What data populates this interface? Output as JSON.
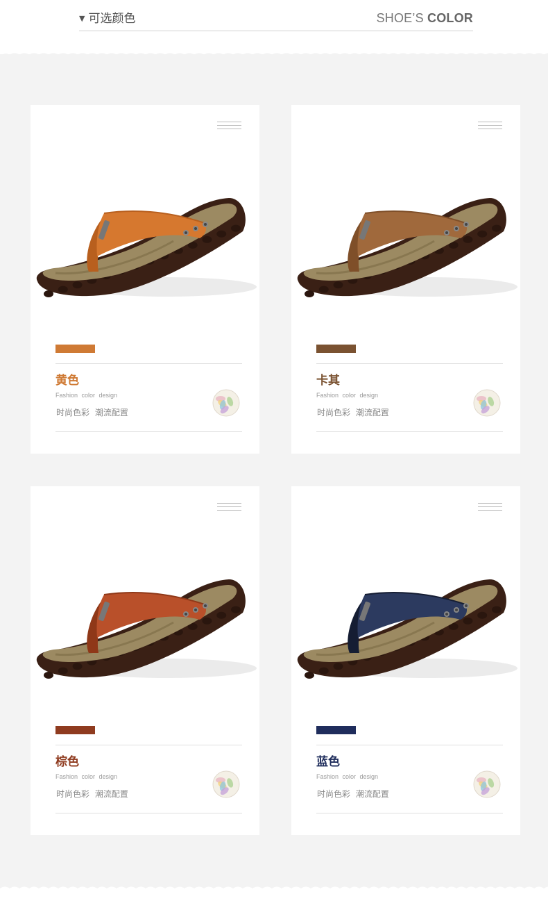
{
  "header": {
    "title_cn": "可选颜色",
    "title_en_light": "SHOE’S",
    "title_en_bold": "COLOR"
  },
  "cards": [
    {
      "name": "黄色",
      "color": "#cf7a34",
      "fashion": "Fashion color design",
      "subtitle": "时尚色彩 潮流配置",
      "strap": "#d6782f",
      "strap_dark": "#b85f1e"
    },
    {
      "name": "卡其",
      "color": "#7a5231",
      "fashion": "Fashion color design",
      "subtitle": "时尚色彩 潮流配置",
      "strap": "#a0693c",
      "strap_dark": "#7f4f29"
    },
    {
      "name": "棕色",
      "color": "#8f3b1f",
      "fashion": "Fashion color design",
      "subtitle": "时尚色彩 潮流配置",
      "strap": "#b9502a",
      "strap_dark": "#8f3818"
    },
    {
      "name": "蓝色",
      "color": "#1f2d5c",
      "fashion": "Fashion color design",
      "subtitle": "时尚色彩 潮流配置",
      "strap": "#2c3a5f",
      "strap_dark": "#151d33"
    }
  ],
  "icons": {
    "menu": "menu-lines-icon",
    "palette": "color-palette-icon",
    "dropdown": "triangle-down-icon"
  }
}
